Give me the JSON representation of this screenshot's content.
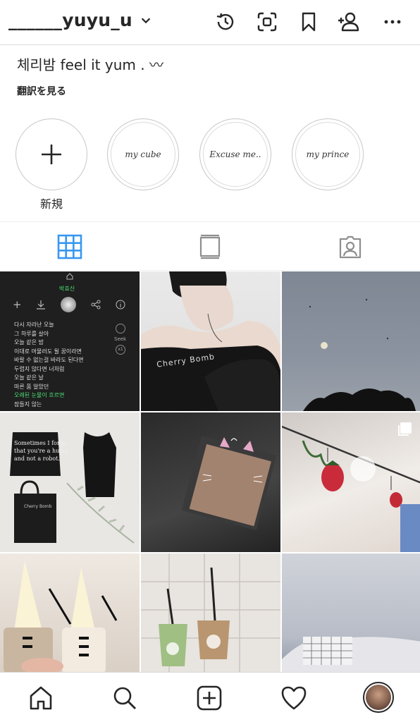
{
  "header": {
    "username": "______yuyu_u",
    "icons": [
      "history-icon",
      "scan-icon",
      "bookmark-icon",
      "add-person-icon",
      "more-icon"
    ]
  },
  "profile": {
    "bio": "체리밤 feel it yum . 〰",
    "translate_label": "翻訳を見る"
  },
  "highlights": [
    {
      "label": "新規",
      "type": "new"
    },
    {
      "label": "",
      "cover_text": "my cube",
      "type": "story"
    },
    {
      "label": "",
      "cover_text": "Excuse me..",
      "type": "story"
    },
    {
      "label": "",
      "cover_text": "my prince",
      "type": "story"
    }
  ],
  "tabs": [
    {
      "name": "grid",
      "active": true
    },
    {
      "name": "igtv",
      "active": false
    },
    {
      "name": "tagged",
      "active": false
    }
  ],
  "posts": {
    "music": {
      "title": "박효신",
      "lyrics": [
        "다시 자라난 오늘",
        "그 하루를 살아",
        "오늘 같은 밤",
        "이대로 머물러도 될 꿈이라면",
        "바랄 수 없는걸 바라도 된다면",
        "두렵지 않다면 너처럼",
        "오늘 같은 날",
        "마른 품 알았던",
        "오래된 눈물이 흐르면",
        "잠들지 않는"
      ],
      "highlight_index": 8,
      "seek_label": "Seek",
      "speed_label": "x1"
    },
    "bomb_shirt_text": "Cherry   Bomb",
    "robot_shirt_text": [
      "Sometimes I forge",
      "that you're a huma",
      "and not a robot."
    ],
    "bag_text": "Cherry Bomb"
  },
  "bottom_nav": {
    "icons": [
      "home-icon",
      "search-icon",
      "new-post-icon",
      "heart-icon",
      "profile-avatar"
    ]
  },
  "colors": {
    "active_tab": "#3897f0",
    "text": "#262626",
    "divider": "#dbdbdb"
  }
}
